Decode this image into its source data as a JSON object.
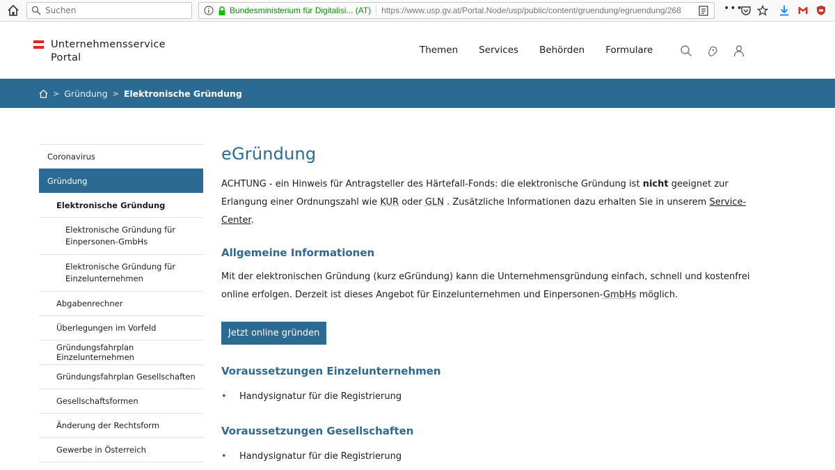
{
  "browser": {
    "search_placeholder": "Suchen",
    "site_identity": "Bundesministerium für Digitalisi... (AT)",
    "url": "https://www.usp.gv.at/Portal.Node/usp/public/content/gruendung/egruendung/268",
    "ellipsis": "•••"
  },
  "header": {
    "logo_line1": "Unternehmensservice",
    "logo_line2": "Portal",
    "nav": [
      "Themen",
      "Services",
      "Behörden",
      "Formulare"
    ]
  },
  "breadcrumb": {
    "items": [
      "Gründung",
      "Elektronische Gründung"
    ]
  },
  "sidebar": {
    "items": [
      "Coronavirus",
      "Gründung",
      "Elektronische Gründung",
      "Elektronische Gründung für Einpersonen-GmbHs",
      "Elektronische Gründung für Einzelunternehmen",
      "Abgabenrechner",
      "Überlegungen im Vorfeld",
      "Gründungsfahrplan Einzelunternehmen",
      "Gründungsfahrplan Gesellschaften",
      "Gesellschaftsformen",
      "Änderung der Rechtsform",
      "Gewerbe in Österreich"
    ]
  },
  "content": {
    "title": "eGründung",
    "notice_part1": "ACHTUNG - ein Hinweis für Antragsteller des Härtefall-Fonds: die elektronische Gründung ist",
    "notice_bold": "nicht",
    "notice_part2": "geeignet zur Erlangung einer Ordnungszahl wie",
    "notice_kur": "KUR",
    "notice_or": "oder",
    "notice_gln": "GLN",
    "notice_part3": ". Zusätzliche Informationen dazu erhalten Sie in unserem",
    "notice_link": "Service-Center",
    "notice_end": ".",
    "section1_title": "Allgemeine Informationen",
    "section1_text_a": "Mit der elektronischen Gründung (kurz eGründung) kann die Unternehmensgründung einfach, schnell und kostenfrei online erfolgen. Derzeit ist dieses Angebot für Einzelunternehmen und Einpersonen-",
    "section1_text_abbr": "GmbHs",
    "section1_text_b": "möglich.",
    "cta_label": "Jetzt online gründen",
    "section2_title": "Voraussetzungen Einzelunternehmen",
    "section2_bullet": "Handysignatur für die Registrierung",
    "section3_title": "Voraussetzungen Gesellschaften",
    "section3_bullet": "Handysignatur für die Registrierung"
  },
  "colors": {
    "brand_blue": "#2b6a93",
    "flag_red": "#e2231a",
    "secure_green": "#058b00"
  }
}
